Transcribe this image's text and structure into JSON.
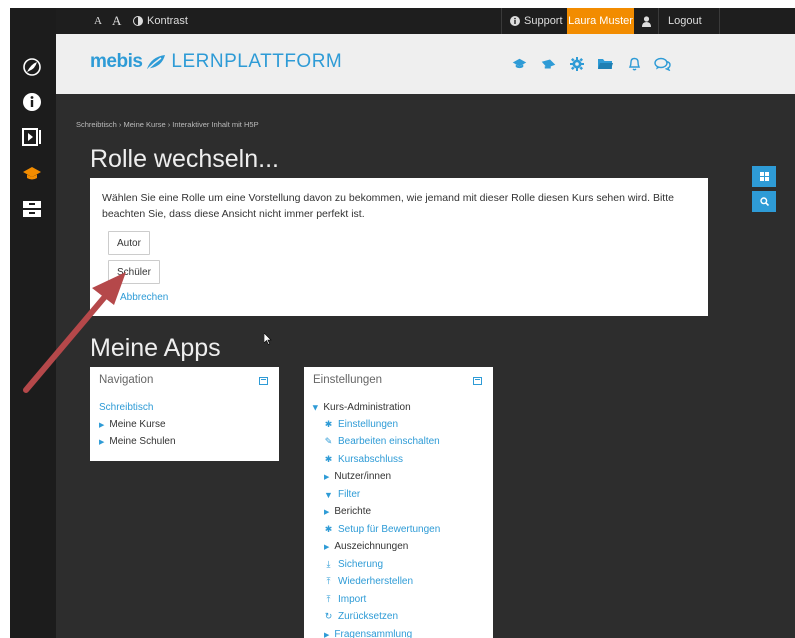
{
  "topbar": {
    "font_smaller": "A",
    "font_larger": "A",
    "contrast_label": "Kontrast",
    "support_label": "Support",
    "user_name": "Laura Muster",
    "logout_label": "Logout"
  },
  "header": {
    "logo_bold": "mebis",
    "logo_text": "LERNPLATTFORM",
    "icons": [
      "graduation-cap-icon",
      "certificate-icon",
      "gear-icon",
      "folder-icon",
      "bell-icon",
      "comments-icon"
    ]
  },
  "breadcrumb": "Schreibtisch › Meine Kurse › Interaktiver Inhalt mit H5P",
  "page_title": "Rolle wechseln...",
  "role_panel": {
    "description": "Wählen Sie eine Rolle um eine Vorstellung davon zu bekommen, wie jemand mit dieser Rolle diesen Kurs sehen wird. Bitte beachten Sie, dass diese Ansicht nicht immer perfekt ist.",
    "buttons": [
      "Autor",
      "Schüler"
    ],
    "cancel_label": "Abbrechen"
  },
  "apps_title": "Meine Apps",
  "navigation_block": {
    "title": "Navigation",
    "top_link": "Schreibtisch",
    "items": [
      "Meine Kurse",
      "Meine Schulen"
    ]
  },
  "settings_block": {
    "title": "Einstellungen",
    "section": "Kurs-Administration",
    "items": [
      {
        "label": "Einstellungen",
        "icon": "gear-icon",
        "link": true
      },
      {
        "label": "Bearbeiten einschalten",
        "icon": "pencil-icon",
        "link": true
      },
      {
        "label": "Kursabschluss",
        "icon": "gear-icon",
        "link": true
      },
      {
        "label": "Nutzer/innen",
        "icon": "triangle-right-icon",
        "link": false
      },
      {
        "label": "Filter",
        "icon": "filter-icon",
        "link": true
      },
      {
        "label": "Berichte",
        "icon": "triangle-right-icon",
        "link": false
      },
      {
        "label": "Setup für Bewertungen",
        "icon": "gear-icon",
        "link": true
      },
      {
        "label": "Auszeichnungen",
        "icon": "triangle-right-icon",
        "link": false
      },
      {
        "label": "Sicherung",
        "icon": "download-icon",
        "link": true
      },
      {
        "label": "Wiederherstellen",
        "icon": "upload-icon",
        "link": true
      },
      {
        "label": "Import",
        "icon": "upload-icon",
        "link": true
      },
      {
        "label": "Zurücksetzen",
        "icon": "refresh-icon",
        "link": true
      },
      {
        "label": "Fragensammlung",
        "icon": "triangle-right-icon",
        "link": true
      }
    ]
  },
  "colors": {
    "accent": "#2e9bd6",
    "user_orange": "#f28c00",
    "annotation_arrow": "#b5484a",
    "background": "#2d2d2d"
  }
}
